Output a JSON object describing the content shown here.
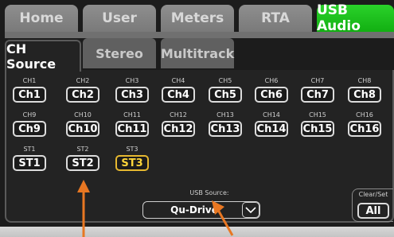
{
  "tabs": [
    {
      "label": "Home",
      "active": false
    },
    {
      "label": "User",
      "active": false
    },
    {
      "label": "Meters",
      "active": false
    },
    {
      "label": "RTA",
      "active": false
    },
    {
      "label": "USB Audio",
      "active": true
    }
  ],
  "subtabs": [
    {
      "label": "CH Source",
      "active": true
    },
    {
      "label": "Stereo",
      "active": false
    },
    {
      "label": "Multitrack",
      "active": false
    }
  ],
  "channels": [
    {
      "id": "CH1",
      "label": "Ch1"
    },
    {
      "id": "CH2",
      "label": "Ch2"
    },
    {
      "id": "CH3",
      "label": "Ch3"
    },
    {
      "id": "CH4",
      "label": "Ch4"
    },
    {
      "id": "CH5",
      "label": "Ch5"
    },
    {
      "id": "CH6",
      "label": "Ch6"
    },
    {
      "id": "CH7",
      "label": "Ch7"
    },
    {
      "id": "CH8",
      "label": "Ch8"
    },
    {
      "id": "CH9",
      "label": "Ch9"
    },
    {
      "id": "CH10",
      "label": "Ch10"
    },
    {
      "id": "CH11",
      "label": "Ch11"
    },
    {
      "id": "CH12",
      "label": "Ch12"
    },
    {
      "id": "CH13",
      "label": "Ch13"
    },
    {
      "id": "CH14",
      "label": "Ch14"
    },
    {
      "id": "CH15",
      "label": "Ch15"
    },
    {
      "id": "CH16",
      "label": "Ch16"
    }
  ],
  "stereo": [
    {
      "id": "ST1",
      "label": "ST1",
      "selected": false
    },
    {
      "id": "ST2",
      "label": "ST2",
      "selected": false
    },
    {
      "id": "ST3",
      "label": "ST3",
      "selected": true
    }
  ],
  "usb_source": {
    "label": "USB Source:",
    "value": "Qu-Drive"
  },
  "clear_set": {
    "label": "Clear/Set",
    "button": "All"
  },
  "colors": {
    "active_tab": "#22c322",
    "selected": "#ffd63a",
    "annotation_arrow": "#e87722"
  },
  "icons": {
    "dropdown": "chevron-down-icon",
    "annotations": "arrow-icon"
  }
}
